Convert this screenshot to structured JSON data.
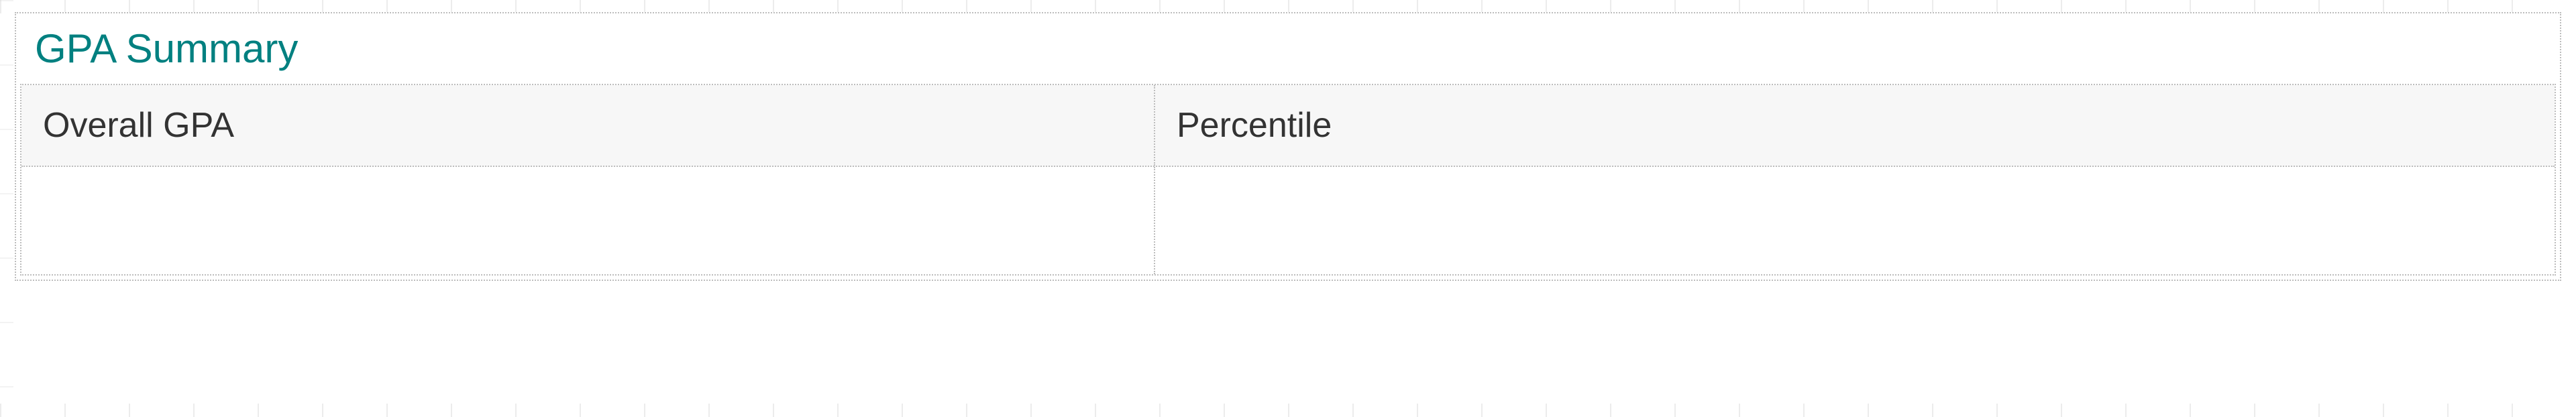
{
  "panel": {
    "title": "GPA Summary",
    "columns": {
      "overall_gpa": "Overall GPA",
      "percentile": "Percentile"
    },
    "values": {
      "overall_gpa": "",
      "percentile": ""
    }
  }
}
